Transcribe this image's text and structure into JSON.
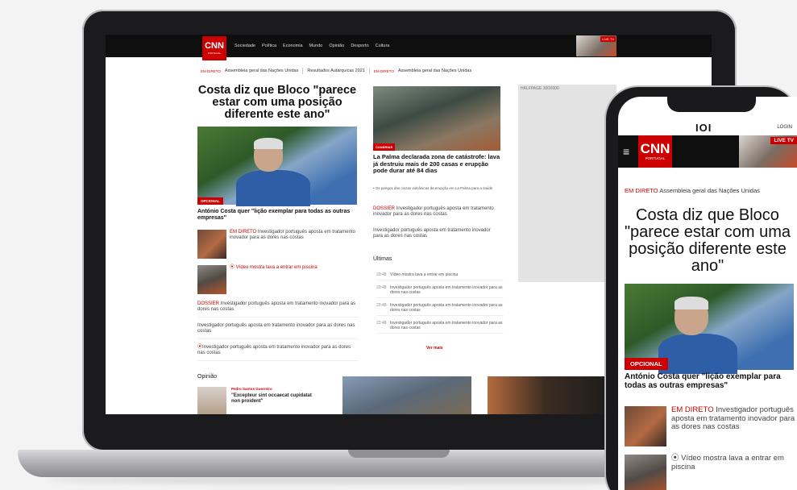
{
  "desktop": {
    "logo": {
      "main": "CNN",
      "sub": "PORTUGAL"
    },
    "nav": [
      "Sociedade",
      "Política",
      "Economia",
      "Mundo",
      "Opinião",
      "Desporto",
      "Cultura"
    ],
    "live_tv": "LIVE TV",
    "ticker": {
      "live1": "EM DIRETO",
      "item1": "Assembleia geral das Nações Unidas",
      "item2": "Resultados Autárquicas 2021",
      "live2": "EM DIRETO",
      "item3": "Assembleia geral das Nações Unidas"
    },
    "hero": {
      "title": "Costa diz que Bloco \"parece estar com uma posição diferente este ano\"",
      "badge": "OPCIONAL",
      "caption": "António Costa quer \"lição exemplar para todas as outras empresas\""
    },
    "side_items": [
      {
        "tag": "EM DIRETO",
        "text": "Investigador português aposta em tratamento inovador para as dores nas costas"
      },
      {
        "tag": "",
        "text": "⦿ Vídeo mostra lava a entrar em piscina"
      }
    ],
    "list_items": [
      {
        "tag": "DOSSIER",
        "text": "Investigador português aposta em tratamento inovador para as dores nas costas"
      },
      {
        "tag": "",
        "text": "Investigador português aposta em tratamento inovador para as dores nas costas"
      },
      {
        "tag": "⦿",
        "text": "Investigador português aposta em tratamento inovador para as dores nas costas"
      }
    ],
    "opinion": {
      "heading": "Opinião",
      "author": "Pedro Santos Guerreiro",
      "quote": "\"Excepteur sint occaecat cupidatat non proident\""
    },
    "col2": {
      "badge": "CANÁRIAS",
      "title": "La Palma declarada zona de catástrofe: lava já destruiu mais de 200 casas e erupção pode durar até 84 dias",
      "sub": "• Os perigos das cinzas vulcânicas da erupção em La Palma para a saúde",
      "items": [
        {
          "tag": "DOSSIER",
          "text": "Investigador português aposta em tratamento inovador para as dores nas costas"
        },
        {
          "tag": "",
          "text": "Investigador português aposta em tratamento inovador para as dores nas costas"
        }
      ],
      "ultimas_heading": "Últimas",
      "ultimas": [
        {
          "time": "22:48",
          "text": "Vídeo mostra lava a entrar em piscina"
        },
        {
          "time": "22:48",
          "text": "Investigador português aposta em tratamento inovador para as dores nas costas"
        },
        {
          "time": "22:48",
          "text": "Investigador português aposta em tratamento inovador para as dores nas costas"
        },
        {
          "time": "22:48",
          "text": "Investigador português aposta em tratamento inovador para as dores nas costas"
        }
      ],
      "ver_mais": "Ver mais"
    },
    "ad_label": "HALFPAGE 300X600"
  },
  "mobile": {
    "brand": "IOI",
    "login": "LOGIN",
    "logo": {
      "main": "CNN",
      "sub": "PORTUGAL"
    },
    "live_tv": "LIVE TV",
    "ticker_live": "EM DIRETO",
    "ticker_text": "Assembleia geral das Nações Unidas",
    "title": "Costa diz que Bloco \"parece estar com uma posição diferente este ano\"",
    "badge": "OPCIONAL",
    "caption": "António Costa quer \"lição exemplar para todas as outras empresas\"",
    "row1_tag": "EM DIRETO",
    "row1_text": "Investigador português aposta em tratamento inovador para as dores nas costas",
    "row2_text": "⦿ Vídeo mostra lava a entrar em piscina"
  }
}
